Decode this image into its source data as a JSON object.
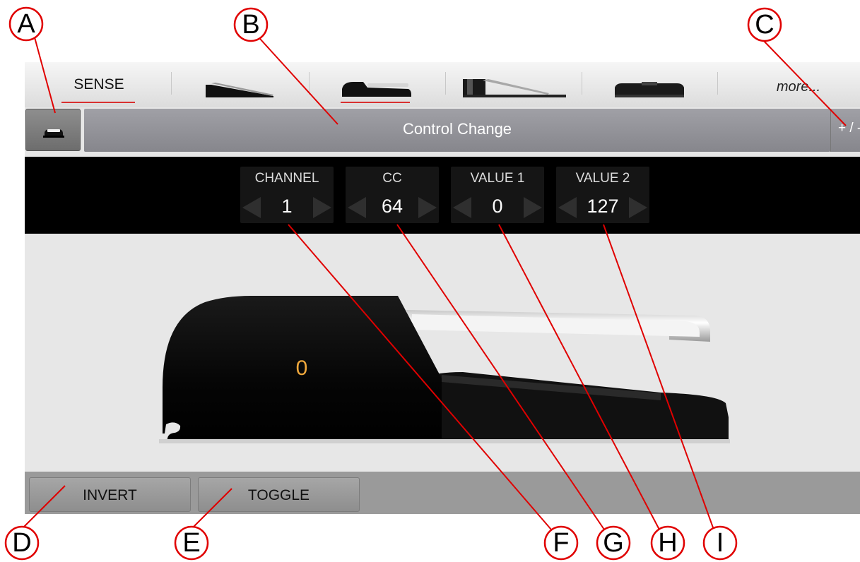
{
  "tabs": {
    "sense_label": "SENSE",
    "more_label": "more...",
    "items": [
      {
        "icon": "expression-pedal-icon"
      },
      {
        "icon": "sustain-pedal-icon"
      },
      {
        "icon": "piano-pedal-icon"
      },
      {
        "icon": "footswitch-icon"
      }
    ],
    "underline_color": "#d93030"
  },
  "mode": {
    "label": "Control Change",
    "plus_minus": "+ / -"
  },
  "params": [
    {
      "label": "CHANNEL",
      "value": "1"
    },
    {
      "label": "CC",
      "value": "64"
    },
    {
      "label": "VALUE 1",
      "value": "0"
    },
    {
      "label": "VALUE 2",
      "value": "127"
    }
  ],
  "pedal": {
    "value": "0",
    "value_color": "#f0a83c"
  },
  "buttons": {
    "invert": "INVERT",
    "toggle": "TOGGLE"
  },
  "callouts": {
    "a": "A",
    "b": "B",
    "c": "C",
    "d": "D",
    "e": "E",
    "f": "F",
    "g": "G",
    "h": "H",
    "i": "I",
    "color": "#e00000"
  }
}
